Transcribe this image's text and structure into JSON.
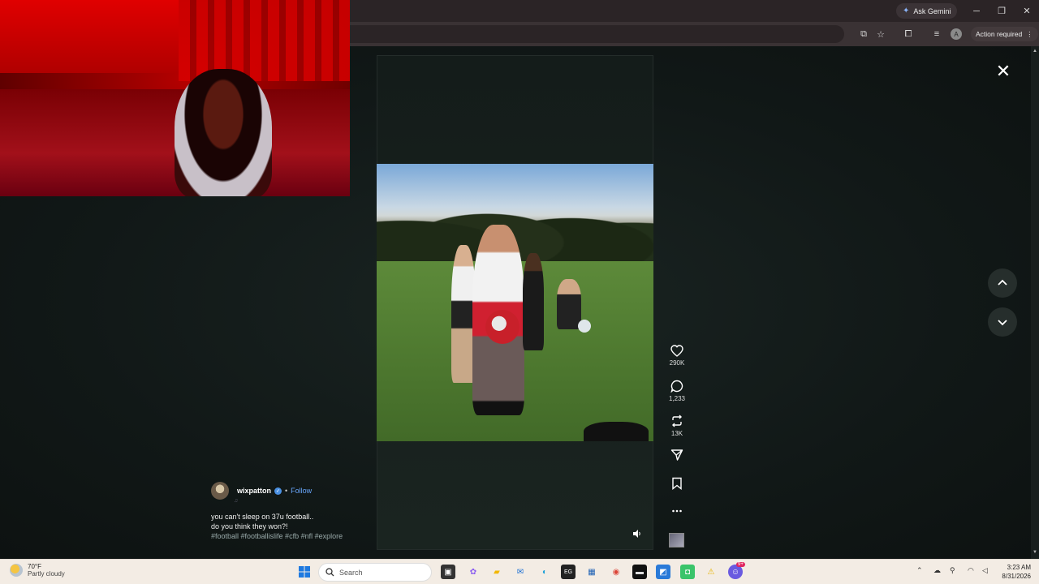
{
  "browser": {
    "ask_gemini": "Ask Gemini",
    "action_required": "Action required",
    "avatar_letter": "A"
  },
  "post": {
    "username": "wixpatton",
    "follow_label": "Follow",
    "separator": "•",
    "caption_line1": "you can't sleep on 37u football..",
    "caption_line2": "do you think they won?!",
    "hashtags": "#football #footballislife #cfb #nfl #explore"
  },
  "actions": {
    "likes": "290K",
    "comments": "1,233",
    "reposts": "13K"
  },
  "taskbar": {
    "temperature": "70°F",
    "weather_condition": "Partly cloudy",
    "search_placeholder": "Search",
    "time": "3:23 AM",
    "date": "8/31/2026",
    "notification_badge": "9+"
  },
  "colors": {
    "follow_link": "#6aa8ff",
    "verified": "#4a90e2",
    "viewer_bg": "#111817"
  },
  "icons": [
    "heart-icon",
    "comment-icon",
    "repost-icon",
    "share-icon",
    "bookmark-icon",
    "more-icon",
    "close-icon",
    "chevron-up-icon",
    "chevron-down-icon",
    "volume-icon"
  ]
}
